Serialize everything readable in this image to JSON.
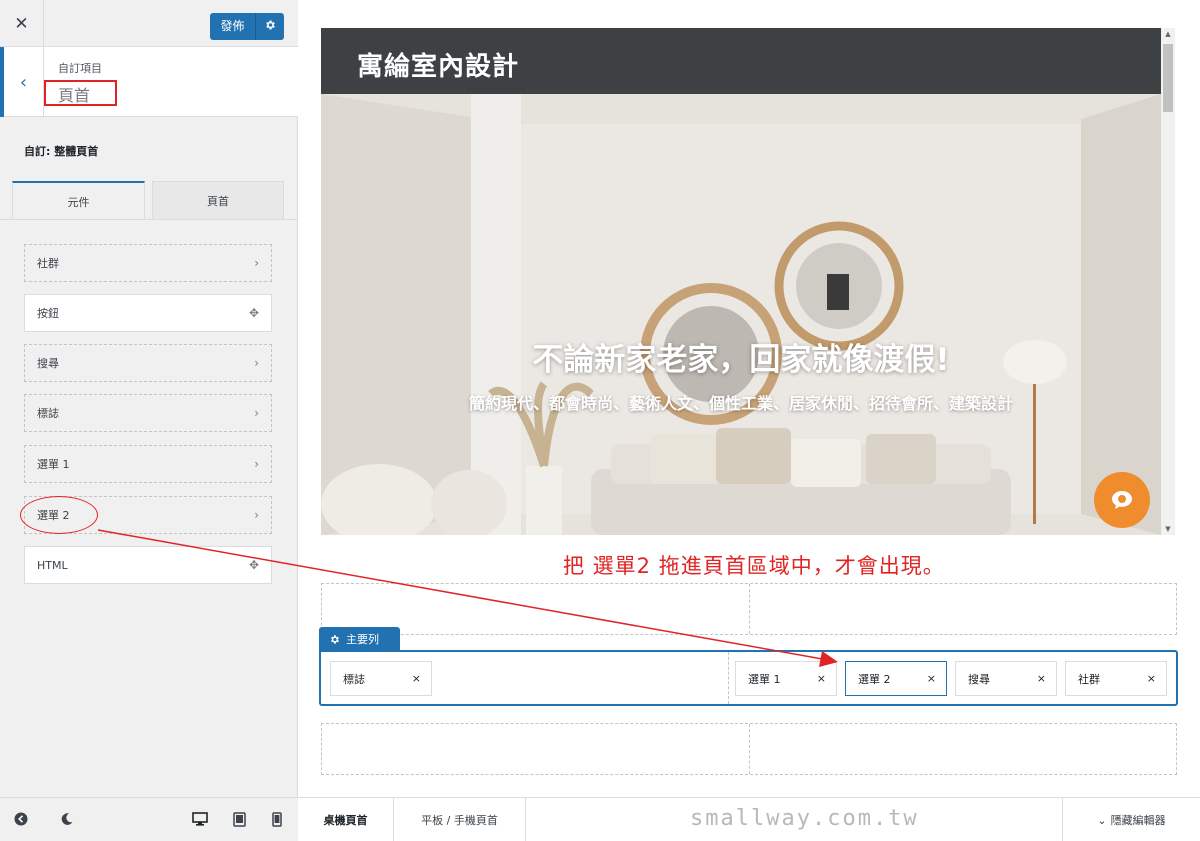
{
  "topbar": {
    "close_icon": "close-icon",
    "publish_label": "發佈",
    "publish_gear_icon": "gear-icon"
  },
  "section": {
    "breadcrumb": "自訂項目",
    "title": "頁首",
    "back_icon": "chevron-left-icon"
  },
  "custom_label": "自訂: 整體頁首",
  "tabs": [
    {
      "label": "元件",
      "active": true
    },
    {
      "label": "頁首",
      "active": false
    }
  ],
  "elements": [
    {
      "label": "社群",
      "style": "dashed",
      "icon": "chevron-right-icon"
    },
    {
      "label": "按鈕",
      "style": "solid",
      "icon": "move-icon"
    },
    {
      "label": "搜尋",
      "style": "dashed",
      "icon": "chevron-right-icon"
    },
    {
      "label": "標誌",
      "style": "dashed",
      "icon": "chevron-right-icon"
    },
    {
      "label": "選單 1",
      "style": "dashed",
      "icon": "chevron-right-icon"
    },
    {
      "label": "選單 2",
      "style": "dashed",
      "icon": "chevron-right-icon"
    },
    {
      "label": "HTML",
      "style": "solid",
      "icon": "move-icon"
    }
  ],
  "bottom_icons": [
    "circle-arrow-icon",
    "moon-icon",
    "desktop-icon",
    "tablet-icon",
    "mobile-icon"
  ],
  "preview": {
    "site_title": "寓綸室內設計",
    "hero_title": "不論新家老家，回家就像渡假!",
    "hero_subtitle": "簡約現代、都會時尚、藝術人文、個性工業、居家休閒、招待會所、建築設計",
    "chat_icon": "chat-bubble-icon"
  },
  "annotation": "把 選單2 拖進頁首區域中，才會出現。",
  "builder": {
    "main_row_label": "主要列",
    "left_chips": [
      {
        "label": "標誌"
      }
    ],
    "right_chips": [
      {
        "label": "選單 1"
      },
      {
        "label": "選單 2",
        "active": true
      },
      {
        "label": "搜尋"
      },
      {
        "label": "社群"
      }
    ],
    "remove_glyph": "×"
  },
  "preview_tabs": [
    {
      "label": "桌機頁首",
      "active": true
    },
    {
      "label": "平板 / 手機頁首",
      "active": false
    }
  ],
  "hide_editor_label": "隱藏編輯器",
  "watermark": "smallway.com.tw",
  "colors": {
    "accent": "#2271b1",
    "annotation_red": "#e02424",
    "chat_orange": "#ef8c2d",
    "site_header": "#3e4144"
  }
}
